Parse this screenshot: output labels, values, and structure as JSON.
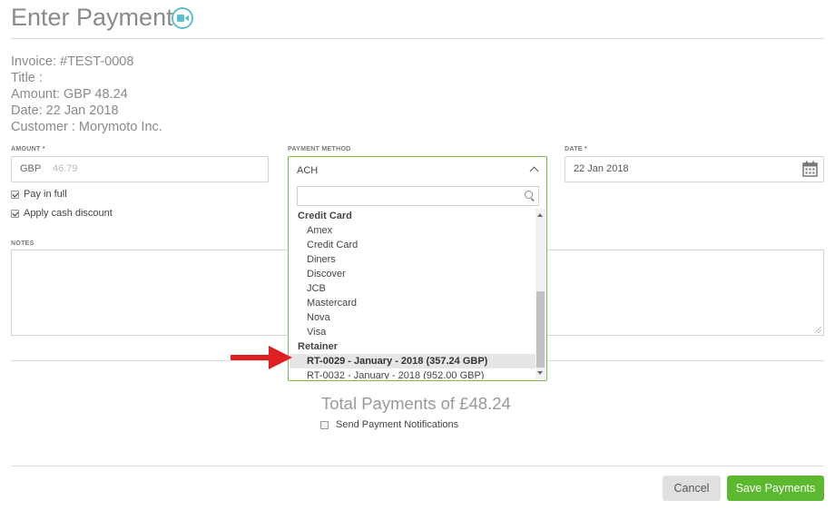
{
  "header": {
    "title": "Enter Payment",
    "video_icon": "video-camera-icon"
  },
  "invoice": {
    "invoice_line": "Invoice: #TEST-0008",
    "title_line": "Title :",
    "amount_line": "Amount: GBP 48.24",
    "date_line": "Date: 22 Jan 2018",
    "customer_line": "Customer : Morymoto Inc."
  },
  "form": {
    "amount_label": "AMOUNT *",
    "amount_currency": "GBP",
    "amount_placeholder": "46.79",
    "payment_method_label": "PAYMENT METHOD",
    "payment_method_value": "ACH",
    "date_label": "DATE *",
    "date_value": "22 Jan 2018",
    "pay_in_full_label": "Pay in full",
    "apply_cash_discount_label": "Apply cash discount",
    "notes_label": "NOTES"
  },
  "dropdown": {
    "search_placeholder": "",
    "options": [
      {
        "label": "Credit Card",
        "kind": "group"
      },
      {
        "label": "Amex",
        "kind": "option"
      },
      {
        "label": "Credit Card",
        "kind": "option"
      },
      {
        "label": "Diners",
        "kind": "option"
      },
      {
        "label": "Discover",
        "kind": "option"
      },
      {
        "label": "JCB",
        "kind": "option"
      },
      {
        "label": "Mastercard",
        "kind": "option"
      },
      {
        "label": "Nova",
        "kind": "option"
      },
      {
        "label": "Visa",
        "kind": "option"
      },
      {
        "label": "Retainer",
        "kind": "group"
      },
      {
        "label": "RT-0029 - January - 2018 (357.24 GBP)",
        "kind": "highlighted"
      },
      {
        "label": "RT-0032 - January - 2018 (952.00 GBP)",
        "kind": "option"
      }
    ]
  },
  "summary": {
    "total_payments": "Total Payments of £48.24",
    "send_notifications_label": "Send Payment Notifications"
  },
  "buttons": {
    "cancel": "Cancel",
    "save": "Save Payments"
  },
  "colors": {
    "accent_green": "#5cb82e",
    "focus_border": "#77c14a",
    "video_icon": "#5bc0c9",
    "annotation_arrow": "#e02020"
  }
}
